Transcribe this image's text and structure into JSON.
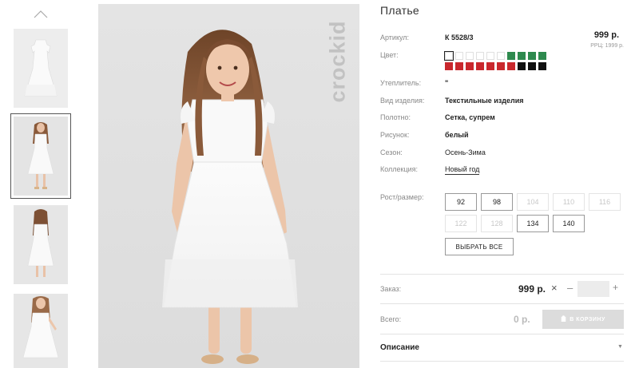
{
  "product": {
    "title": "Платье",
    "price": "999 р.",
    "rrp": "РРЦ: 1999 р.",
    "brand": "crockid"
  },
  "attributes": [
    {
      "label": "Артикул:",
      "value": "К 5528/3"
    },
    {
      "label": "Цвет:",
      "value": ""
    },
    {
      "label": "Утеплитель:",
      "value": "\""
    },
    {
      "label": "Вид изделия:",
      "value": "Текстильные изделия"
    },
    {
      "label": "Полотно:",
      "value": "Сетка, супрем"
    },
    {
      "label": "Рисунок:",
      "value": "белый"
    },
    {
      "label": "Сезон:",
      "value": "Осень-Зима"
    },
    {
      "label": "Коллекция:",
      "value": "Новый год"
    }
  ],
  "colors": {
    "row1": [
      "#ffffff",
      "#ffffff",
      "#ffffff",
      "#ffffff",
      "#ffffff",
      "#ffffff",
      "#2e8a4e",
      "#2e8a4e",
      "#2e8a4e",
      "#2e8a4e"
    ],
    "row2": [
      "#c9282d",
      "#c9282d",
      "#c9282d",
      "#c9282d",
      "#c9282d",
      "#c9282d",
      "#c9282d",
      "#111111",
      "#111111",
      "#111111"
    ]
  },
  "sizes": {
    "label": "Рост/размер:",
    "row1": [
      {
        "value": "92",
        "available": true
      },
      {
        "value": "98",
        "available": true
      },
      {
        "value": "104",
        "available": false
      },
      {
        "value": "110",
        "available": false
      },
      {
        "value": "116",
        "available": false
      }
    ],
    "row2": [
      {
        "value": "122",
        "available": false
      },
      {
        "value": "128",
        "available": false
      },
      {
        "value": "134",
        "available": true
      },
      {
        "value": "140",
        "available": true
      }
    ],
    "select_all": "ВЫБРАТЬ ВСЕ"
  },
  "order": {
    "label": "Заказ:",
    "price": "999 р.",
    "times": "×",
    "minus": "–",
    "plus": "+",
    "quantity": ""
  },
  "total": {
    "label": "Всего:",
    "value": "0 р.",
    "cart_button": "В КОРЗИНУ"
  },
  "description": {
    "label": "Описание",
    "arrow": "▼"
  },
  "icons": {
    "up": "chevron-up-icon",
    "cart": "cart-icon"
  }
}
